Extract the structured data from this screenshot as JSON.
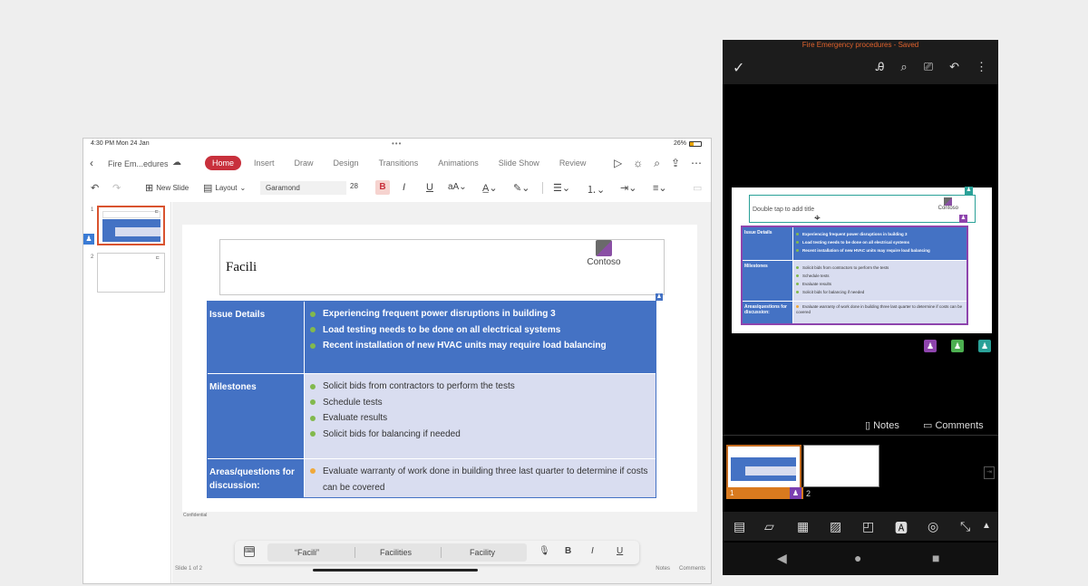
{
  "ipad": {
    "status": {
      "time": "4:30 PM  Mon 24 Jan",
      "dots": "•••",
      "battery": "26%"
    },
    "file_name": "Fire Em...edures",
    "tabs": [
      "Home",
      "Insert",
      "Draw",
      "Design",
      "Transitions",
      "Animations",
      "Slide Show",
      "Review"
    ],
    "ribbon": {
      "new_slide": "New Slide",
      "layout": "Layout",
      "font": "Garamond",
      "size": "28",
      "bold": "B",
      "italic": "I",
      "underline": "U"
    },
    "thumbs": {
      "n1": "1",
      "n2": "2"
    },
    "slide": {
      "confidential": "Confidential",
      "title": "Facili",
      "logo_text": "Contoso",
      "rows": [
        {
          "header": "Issue Details",
          "bullets": [
            "Experiencing frequent power disruptions in building 3",
            "Load testing needs to be done on all electrical systems",
            "Recent installation of new HVAC units may require load balancing"
          ]
        },
        {
          "header": "Milestones",
          "bullets": [
            "Solicit bids from contractors to perform the tests",
            "Schedule tests",
            "Evaluate results",
            "Solicit bids for balancing if needed"
          ]
        },
        {
          "header": "Areas/questions for discussion:",
          "bullets": [
            "Evaluate warranty of work done in building three last quarter to determine if costs can be covered"
          ]
        }
      ]
    },
    "predictive": {
      "s1": "“Facili”",
      "s2": "Facilities",
      "s3": "Facility",
      "bold": "B",
      "italic": "I",
      "underline": "U"
    },
    "footer": {
      "slide_count": "Slide 1 of 2",
      "notes": "Notes",
      "comments": "Comments"
    }
  },
  "phone": {
    "title": "Fire Emergency procedures - Saved",
    "slide": {
      "title_placeholder": "Double tap to add title",
      "logo_text": "Contoso",
      "rows": [
        {
          "header": "Issue Details",
          "bullets": [
            "Experiencing frequent power disruptions in building 3",
            "Load testing needs to be done on all electrical systems",
            "Recent installation of new HVAC units may require load balancing"
          ]
        },
        {
          "header": "Milestones",
          "bullets": [
            "Solicit bids from contractors to perform the tests",
            "Schedule tests",
            "Evaluate results",
            "Solicit bids for balancing if needed"
          ]
        },
        {
          "header": "Areas/questions for discussion:",
          "bullets": [
            "Evaluate warranty of work done in building three last quarter to determine if costs can be covered"
          ]
        }
      ]
    },
    "notes": "Notes",
    "comments": "Comments",
    "thumbs": {
      "n1": "1",
      "n2": "2"
    }
  },
  "colors": {
    "accent_red": "#c8303c",
    "table_blue": "#4472c4",
    "table_light": "#d9ddf0",
    "bullet_green": "#82b94d",
    "bullet_orange": "#f0a93a",
    "phone_title_orange": "#e0622c",
    "presence_purple": "#8e44ad",
    "presence_green": "#4caf50",
    "presence_teal": "#2aa198"
  }
}
